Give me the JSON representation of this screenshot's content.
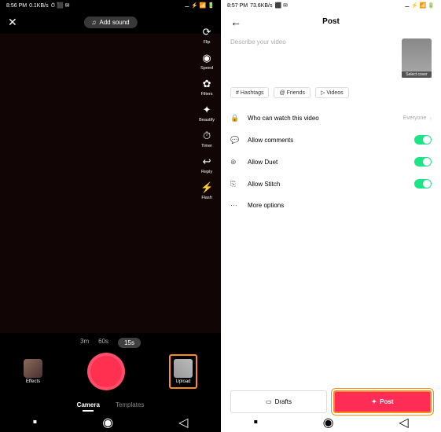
{
  "left_phone": {
    "status": {
      "time": "8:56 PM",
      "net": "0.1KB/s",
      "icons": "⏱ ⬛ ✉",
      "right": "⚊ ⚡ 📶 🔋"
    },
    "close": "✕",
    "add_sound": {
      "icon": "♫",
      "label": "Add sound"
    },
    "tools": [
      {
        "icon": "⟳",
        "label": "Flip"
      },
      {
        "icon": "◉",
        "label": "Speed"
      },
      {
        "icon": "✿",
        "label": "Filters"
      },
      {
        "icon": "✦",
        "label": "Beautify"
      },
      {
        "icon": "⏱",
        "label": "Timer"
      },
      {
        "icon": "↩",
        "label": "Reply"
      },
      {
        "icon": "⚡",
        "label": "Flash"
      }
    ],
    "durations": [
      "3m",
      "60s",
      "15s"
    ],
    "active_duration": "15s",
    "effects_label": "Effects",
    "upload_label": "Upload",
    "modes": [
      "Camera",
      "Templates"
    ],
    "active_mode": "Camera"
  },
  "right_phone": {
    "status": {
      "time": "8:57 PM",
      "net": "73.6KB/s",
      "icons": "⬛ ✉",
      "right": "⚊ ⚡ 📶 🔋"
    },
    "back": "←",
    "title": "Post",
    "description_placeholder": "Describe your video",
    "cover_label": "Select cover",
    "chips": [
      {
        "icon": "#",
        "label": "Hashtags"
      },
      {
        "icon": "@",
        "label": "Friends"
      },
      {
        "icon": "▷",
        "label": "Videos"
      }
    ],
    "settings": [
      {
        "icon": "🔒",
        "label": "Who can watch this video",
        "value": "Everyone",
        "type": "link"
      },
      {
        "icon": "💬",
        "label": "Allow comments",
        "type": "toggle",
        "on": true
      },
      {
        "icon": "⊕",
        "label": "Allow Duet",
        "type": "toggle",
        "on": true
      },
      {
        "icon": "⎘",
        "label": "Allow Stitch",
        "type": "toggle",
        "on": true
      },
      {
        "icon": "⋯",
        "label": "More options",
        "type": "link"
      }
    ],
    "drafts": {
      "icon": "▭",
      "label": "Drafts"
    },
    "post": {
      "icon": "✦",
      "label": "Post"
    }
  }
}
